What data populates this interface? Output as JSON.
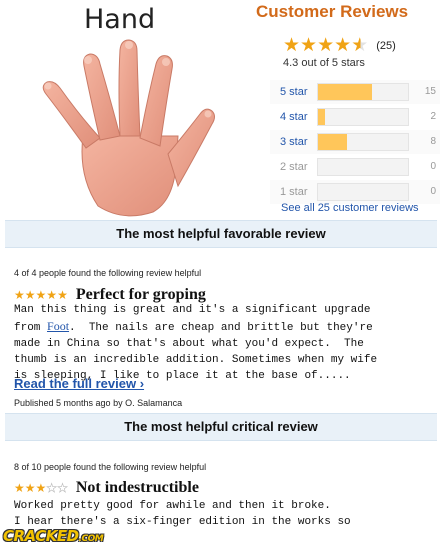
{
  "product": {
    "title": "Hand"
  },
  "reviews": {
    "heading": "Customer Reviews",
    "rating": 4.3,
    "rating_stars": [
      "full",
      "full",
      "full",
      "full",
      "half"
    ],
    "count_text": "(25)",
    "average_text": "4.3 out of 5 stars",
    "histogram": [
      {
        "label": "5 star",
        "count": "15",
        "fraction": 0.6,
        "active": true
      },
      {
        "label": "4 star",
        "count": "2",
        "fraction": 0.08,
        "active": true
      },
      {
        "label": "3 star",
        "count": "8",
        "fraction": 0.32,
        "active": true
      },
      {
        "label": "2 star",
        "count": "0",
        "fraction": 0,
        "active": false
      },
      {
        "label": "1 star",
        "count": "0",
        "fraction": 0,
        "active": false
      }
    ],
    "see_all": "See all 25 customer reviews"
  },
  "favorable": {
    "section_title": "The most helpful favorable review",
    "helpful_text": "4 of 4 people found the following review helpful",
    "stars": 5,
    "title": "Perfect for groping",
    "body_before_link": "Man this thing is great and it's a significant upgrade\nfrom ",
    "body_link": "Foot",
    "body_after_link": ".  The nails are cheap and brittle but they're\nmade in China so that's about what you'd expect.  The\nthumb is an incredible addition. Sometimes when my wife\nis sleeping, I like to place it at the base of.....",
    "read_more": "Read the full review ›",
    "published": "Published 5 months ago by O. Salamanca"
  },
  "critical": {
    "section_title": "The most helpful critical review",
    "helpful_text": "8 of 10 people found the following review helpful",
    "stars": 3,
    "title": "Not indestructible",
    "body": "Worked pretty good for awhile and then it broke.\nI hear there's a six-finger edition in the works so"
  },
  "watermark": {
    "text": "CRACKED",
    "suffix": ".COM"
  },
  "colors": {
    "accent_orange": "#d26a1a",
    "link_blue": "#2255aa",
    "star": "#f0a315",
    "bar_fill": "#ffc65a",
    "section_bg": "#e9f1f8"
  },
  "icons": {
    "hand_image": "hand-photo",
    "rating_star": "star-icon"
  }
}
